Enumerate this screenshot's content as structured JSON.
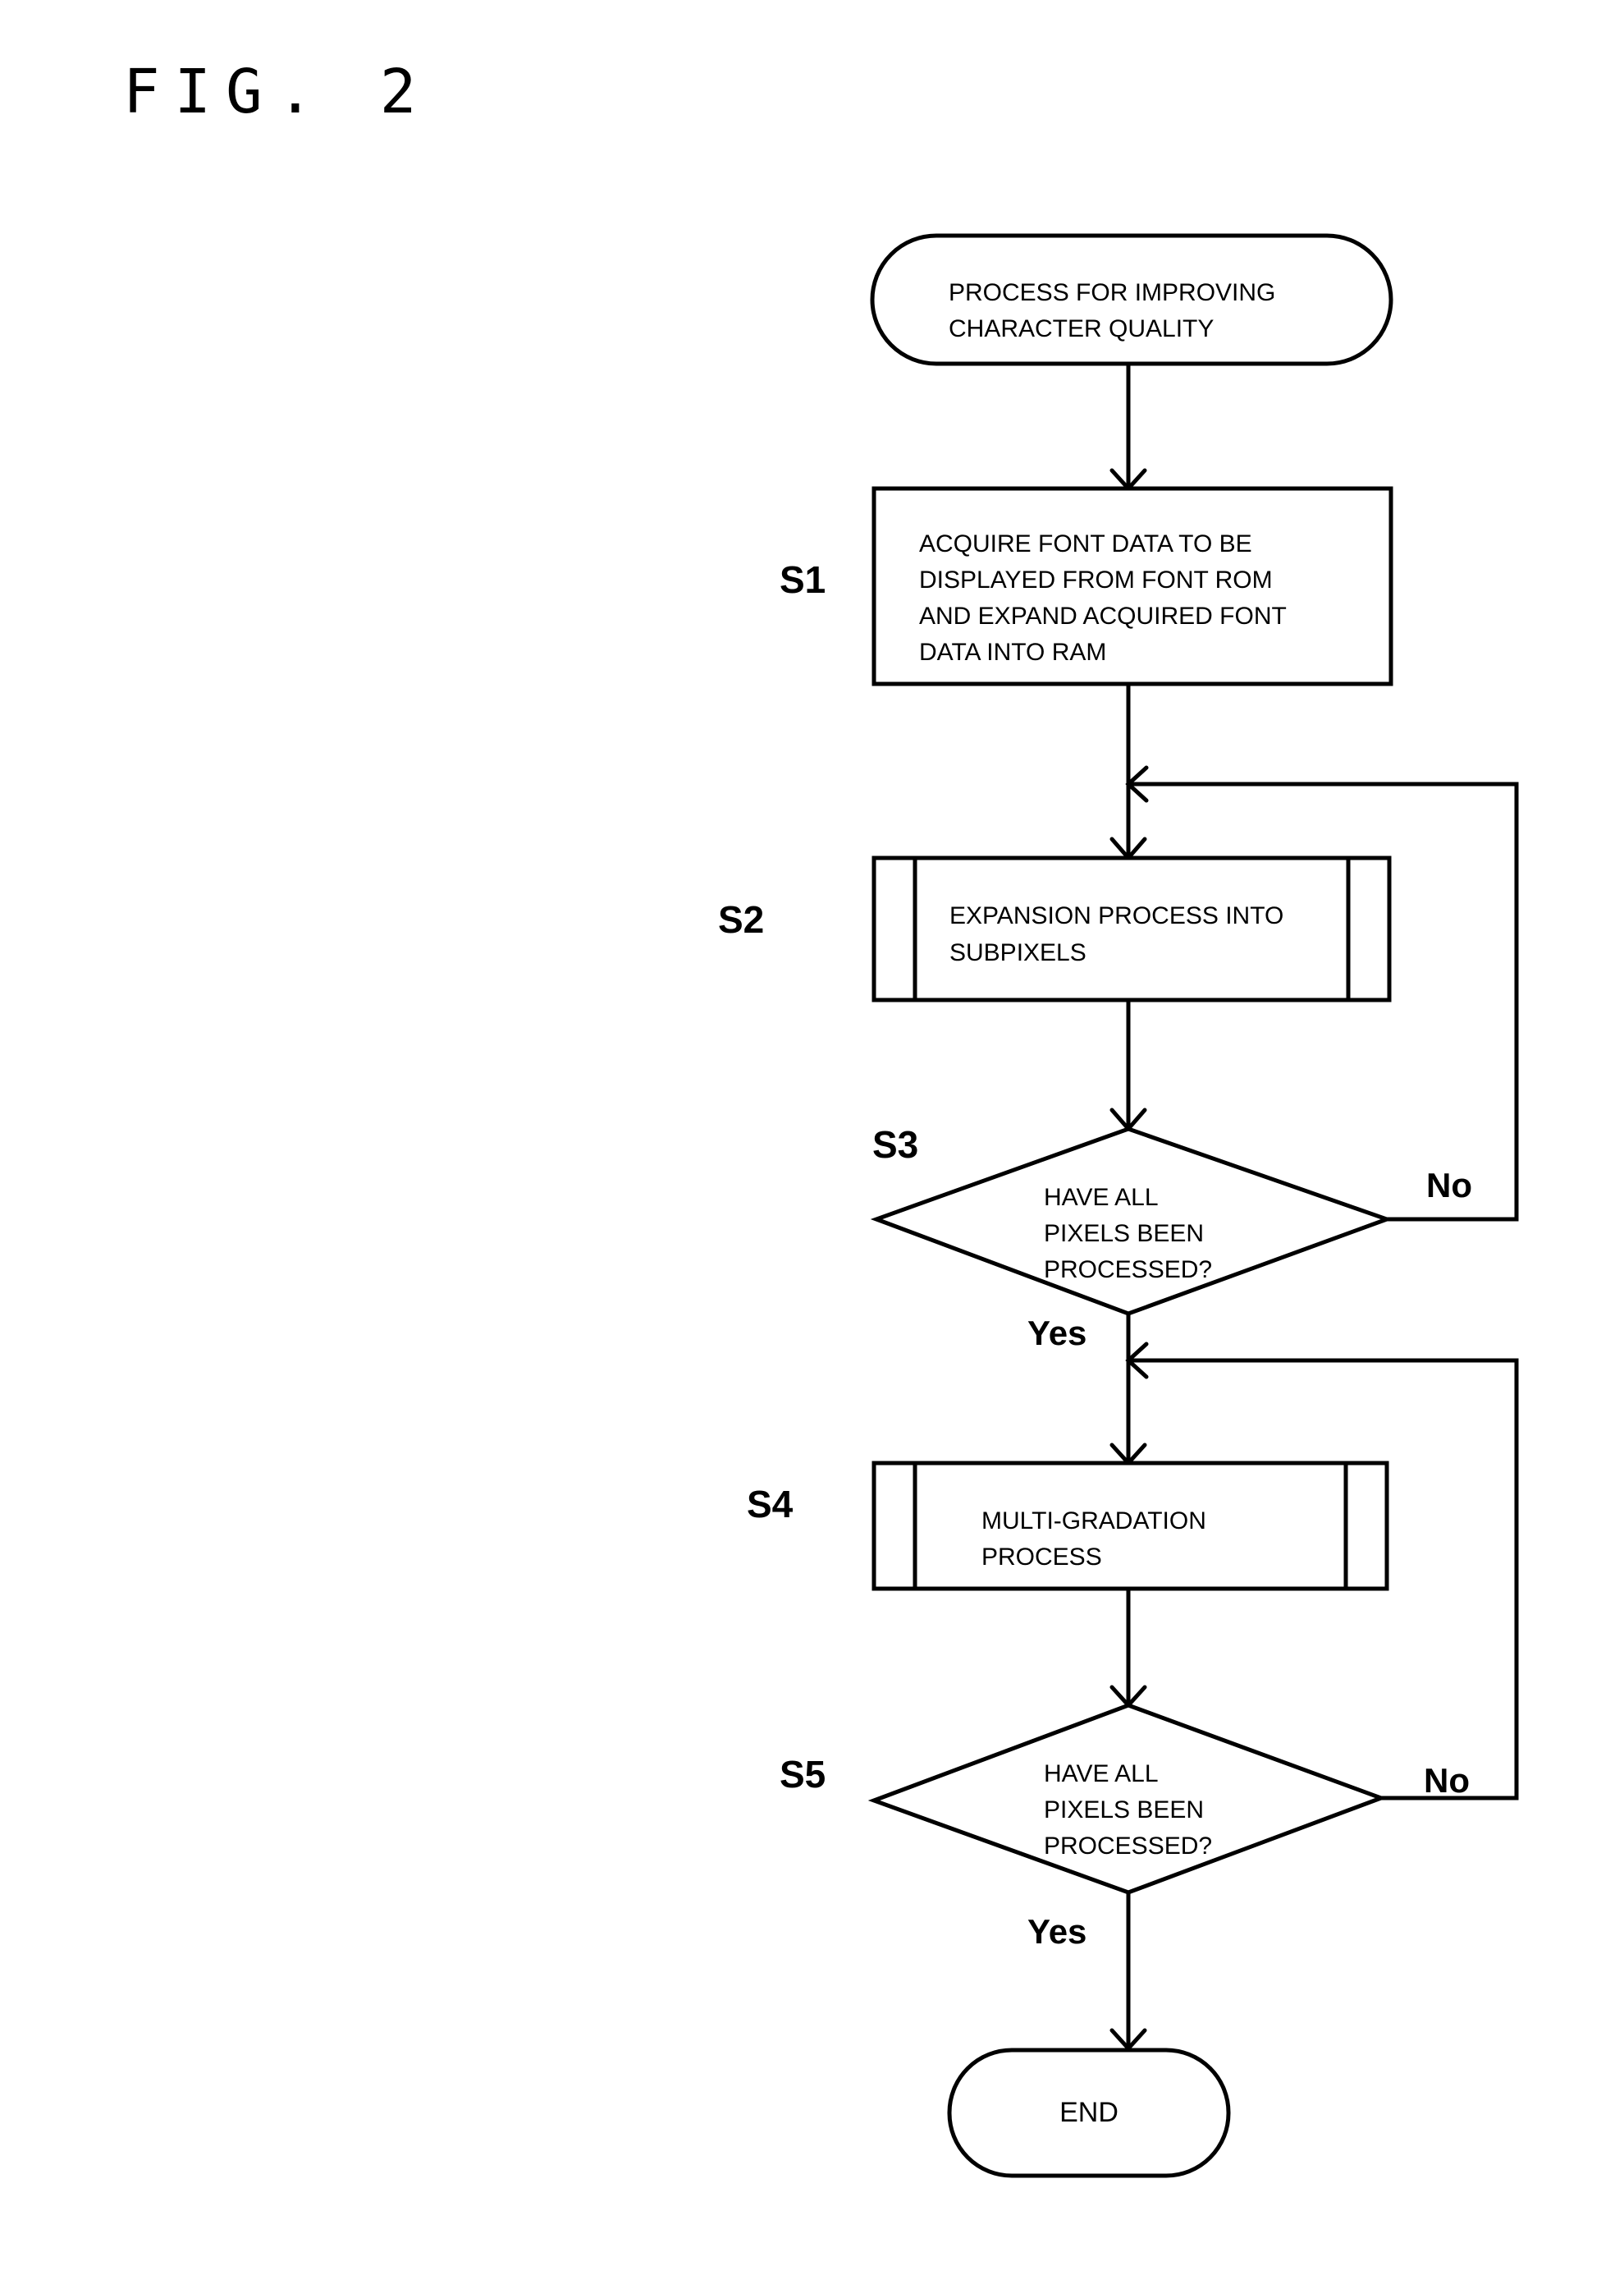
{
  "figure": {
    "title": "FIG. 2"
  },
  "flowchart": {
    "start": {
      "lines": [
        "PROCESS FOR IMPROVING",
        "CHARACTER QUALITY"
      ]
    },
    "steps": [
      {
        "id": "S1",
        "type": "process",
        "label": "S1",
        "lines": [
          "ACQUIRE FONT DATA TO BE",
          "DISPLAYED FROM FONT ROM",
          "AND EXPAND ACQUIRED FONT",
          "DATA INTO RAM"
        ]
      },
      {
        "id": "S2",
        "type": "subroutine",
        "label": "S2",
        "lines": [
          "EXPANSION PROCESS INTO",
          "SUBPIXELS"
        ]
      },
      {
        "id": "S3",
        "type": "decision",
        "label": "S3",
        "lines": [
          "HAVE ALL",
          "PIXELS BEEN",
          "PROCESSED?"
        ],
        "no_label": "No",
        "yes_label": "Yes"
      },
      {
        "id": "S4",
        "type": "subroutine",
        "label": "S4",
        "lines": [
          "MULTI-GRADATION",
          "PROCESS"
        ]
      },
      {
        "id": "S5",
        "type": "decision",
        "label": "S5",
        "lines": [
          "HAVE ALL",
          "PIXELS BEEN",
          "PROCESSED?"
        ],
        "no_label": "No",
        "yes_label": "Yes"
      }
    ],
    "end": {
      "lines": [
        "END"
      ]
    }
  }
}
